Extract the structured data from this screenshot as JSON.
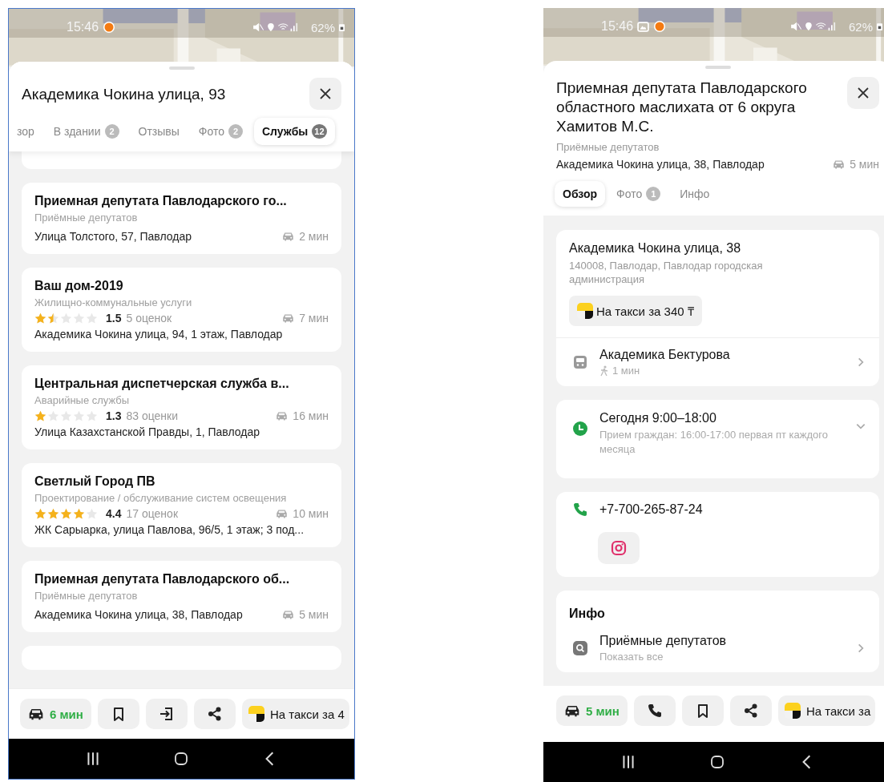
{
  "list_screen": {
    "status_bar": {
      "time": "15:46",
      "battery": "62%",
      "image_notification": false
    },
    "title": "Академика Чокина улица, 93",
    "tabs": [
      {
        "label": "зор",
        "selected": false
      },
      {
        "label": "В здании",
        "count": "2",
        "selected": false
      },
      {
        "label": "Отзывы",
        "selected": false
      },
      {
        "label": "Фото",
        "count": "2",
        "selected": false
      },
      {
        "label": "Службы",
        "count": "12",
        "selected": true
      }
    ],
    "results": [
      {
        "kind": "plain",
        "name": "Приемная депутата Павлодарского го...",
        "category": "Приёмные депутатов",
        "address": "Улица Толстого, 57, Павлодар",
        "drive_time": "2 мин"
      },
      {
        "kind": "rated",
        "name": "Ваш дом-2019",
        "category": "Жилищно-коммунальные услуги",
        "stars": 1.5,
        "rating": "1.5",
        "reviews": "5 оценок",
        "drive_time": "7 мин",
        "address": "Академика Чокина улица, 94, 1 этаж, Павлодар"
      },
      {
        "kind": "rated",
        "name": "Центральная диспетчерская служба в...",
        "category": "Аварийные службы",
        "stars": 1,
        "rating": "1.3",
        "reviews": "83 оценки",
        "drive_time": "16 мин",
        "address": "Улица Казахстанской Правды, 1, Павлодар"
      },
      {
        "kind": "rated",
        "name": "Светлый Город ПВ",
        "category": "Проектирование / обслуживание систем освещения",
        "stars": 4,
        "rating": "4.4",
        "reviews": "17 оценок",
        "drive_time": "10 мин",
        "address": "ЖК Сарыарка, улица Павлова, 96/5, 1 этаж; 3 под..."
      },
      {
        "kind": "plain",
        "name": "Приемная депутата Павлодарского об...",
        "category": "Приёмные депутатов",
        "address": "Академика Чокина улица, 38, Павлодар",
        "drive_time": "5 мин"
      }
    ],
    "actions": {
      "route_time": "6 мин",
      "taxi": "На такси за 4"
    }
  },
  "place_screen": {
    "status_bar": {
      "time": "15:46",
      "battery": "62%",
      "image_notification": true
    },
    "title": "Приемная депутата Павлодарского областного маслихата от 6 округа Хамитов М.С.",
    "category": "Приёмные депутатов",
    "address": "Академика Чокина улица, 38, Павлодар",
    "drive_time": "5 мин",
    "tabs": [
      {
        "label": "Обзор",
        "selected": true
      },
      {
        "label": "Фото",
        "count": "1",
        "selected": false
      },
      {
        "label": "Инфо",
        "selected": false
      }
    ],
    "address_card": {
      "street": "Академика Чокина улица, 38",
      "details": "140008, Павлодар, Павлодар городская администрация",
      "taxi": "На такси за 340 ₸"
    },
    "stop": {
      "name": "Академика Бектурова",
      "walk": "1 мин"
    },
    "hours": {
      "today": "Сегодня 9:00–18:00",
      "note": "Прием граждан: 16:00-17:00 первая пт каждого месяца",
      "expanded": false
    },
    "phone": "+7-700-265-87-24",
    "info": {
      "heading": "Инфо",
      "category": "Приёмные депутатов",
      "link": "Показать все"
    },
    "actions": {
      "route_time": "5 мин",
      "taxi": "На такси за"
    }
  }
}
